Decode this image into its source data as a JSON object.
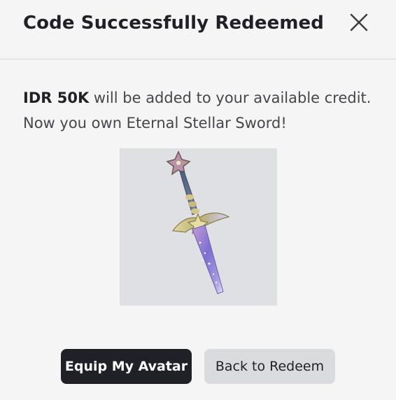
{
  "dialog": {
    "title": "Code Successfully Redeemed",
    "close_icon": "close-icon"
  },
  "message": {
    "amount": "IDR 50K",
    "line1_rest": " will be added to your available credit.",
    "line2": "Now you own Eternal Stellar Sword!"
  },
  "item": {
    "image_icon": "sword-icon",
    "background_color": "#dfe0e4"
  },
  "actions": {
    "primary_label": "Equip My Avatar",
    "secondary_label": "Back to Redeem"
  },
  "colors": {
    "primary_button": "#1f2126",
    "secondary_button": "#dadbde",
    "page_background": "#f5f5f6"
  }
}
